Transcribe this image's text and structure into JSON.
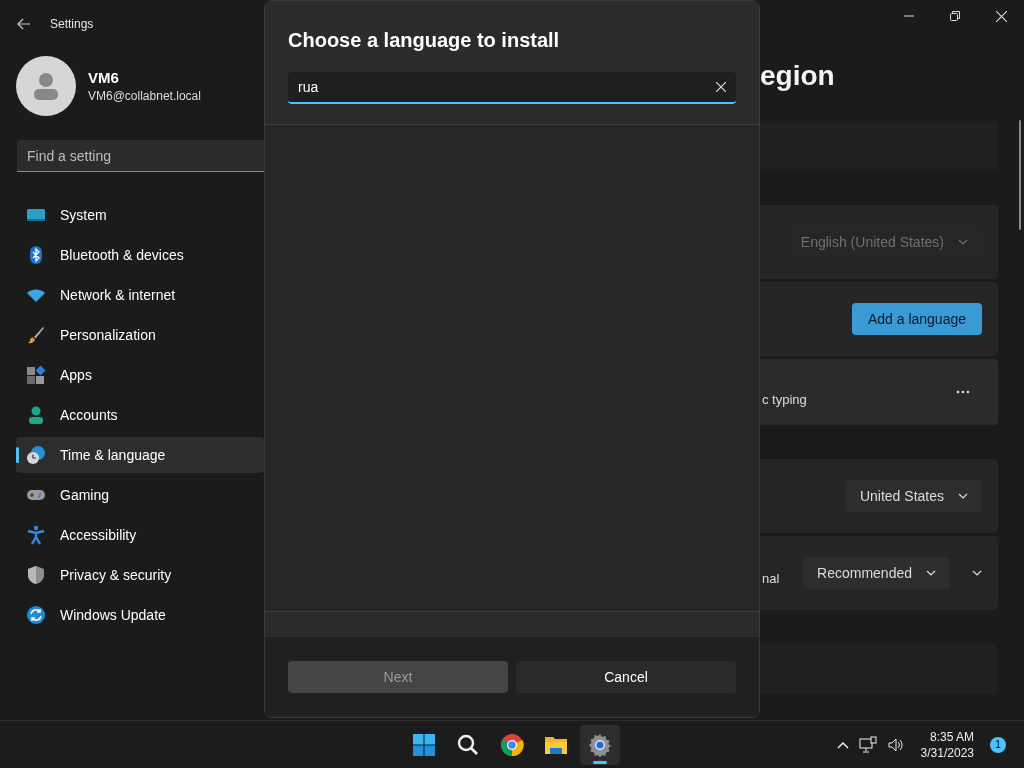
{
  "title_bar": {
    "title": "Settings"
  },
  "account": {
    "name": "VM6",
    "email": "VM6@collabnet.local"
  },
  "search": {
    "placeholder": "Find a setting"
  },
  "nav": [
    {
      "label": "System",
      "selected": false
    },
    {
      "label": "Bluetooth & devices",
      "selected": false
    },
    {
      "label": "Network & internet",
      "selected": false
    },
    {
      "label": "Personalization",
      "selected": false
    },
    {
      "label": "Apps",
      "selected": false
    },
    {
      "label": "Accounts",
      "selected": false
    },
    {
      "label": "Time & language",
      "selected": true
    },
    {
      "label": "Gaming",
      "selected": false
    },
    {
      "label": "Accessibility",
      "selected": false
    },
    {
      "label": "Privacy & security",
      "selected": false
    },
    {
      "label": "Windows Update",
      "selected": false
    }
  ],
  "page": {
    "title": "egion",
    "groups": [
      [
        {
          "kind": "blank"
        }
      ],
      [
        {
          "kind": "dropdown",
          "value": "English (United States)",
          "disabled": true
        },
        {
          "kind": "button",
          "label": "Add a language"
        },
        {
          "kind": "more",
          "text": "c typing"
        }
      ],
      [
        {
          "kind": "dropdown",
          "value": "United States",
          "disabled": false
        },
        {
          "kind": "dropdown",
          "text": "nal",
          "value": "Recommended",
          "disabled": false,
          "expandable": true
        }
      ],
      [
        {
          "kind": "blank"
        }
      ]
    ]
  },
  "dialog": {
    "title": "Choose a language to install",
    "search": {
      "value": "rua"
    },
    "buttons": [
      {
        "label": "Next",
        "disabled": true
      },
      {
        "label": "Cancel",
        "disabled": false
      }
    ]
  },
  "taskbar": {
    "apps": [
      {
        "active": false
      },
      {
        "active": false
      },
      {
        "active": false
      },
      {
        "active": false
      },
      {
        "active": true
      }
    ],
    "time": "8:35 AM",
    "date": "3/31/2023",
    "badge": "1"
  }
}
